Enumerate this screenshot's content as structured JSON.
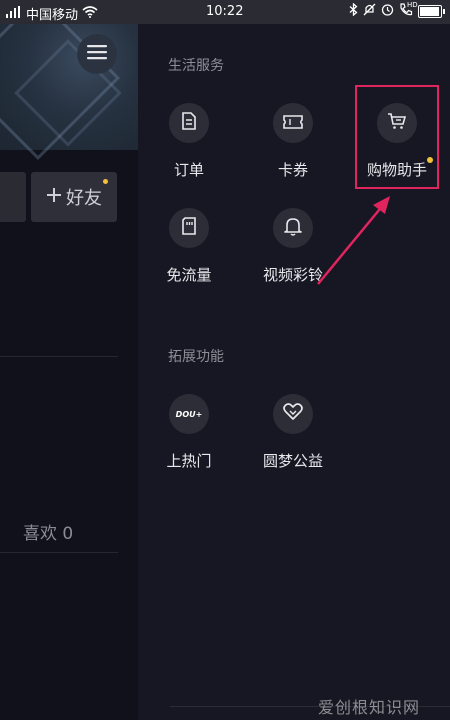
{
  "status_bar": {
    "signal_label": "⁴ᴳ",
    "carrier": "中国移动",
    "time": "10:22",
    "battery_level": 0.85,
    "icons": [
      "signal-icon",
      "wifi-icon",
      "bluetooth-icon",
      "mute-icon",
      "alarm-icon",
      "hd-call-icon",
      "battery-icon"
    ],
    "hd_label": "HD"
  },
  "profile": {
    "add_friend_label": "好友",
    "likes_label": "喜欢 0"
  },
  "drawer": {
    "life_services": {
      "title": "生活服务",
      "items": [
        {
          "label": "订单",
          "icon": "order-icon"
        },
        {
          "label": "卡券",
          "icon": "ticket-icon"
        },
        {
          "label": "购物助手",
          "icon": "cart-icon",
          "badge": true
        },
        {
          "label": "免流量",
          "icon": "sim-card-icon"
        },
        {
          "label": "视频彩铃",
          "icon": "bell-icon"
        }
      ]
    },
    "extended_features": {
      "title": "拓展功能",
      "items": [
        {
          "label": "上热门",
          "icon": "dou-plus-icon",
          "icon_text": "DOU+"
        },
        {
          "label": "圆梦公益",
          "icon": "heart-icon"
        }
      ]
    }
  },
  "watermark": "爱创根知识网",
  "colors": {
    "highlight": "#e0245e",
    "badge": "#f3c13a",
    "background": "#161722"
  }
}
